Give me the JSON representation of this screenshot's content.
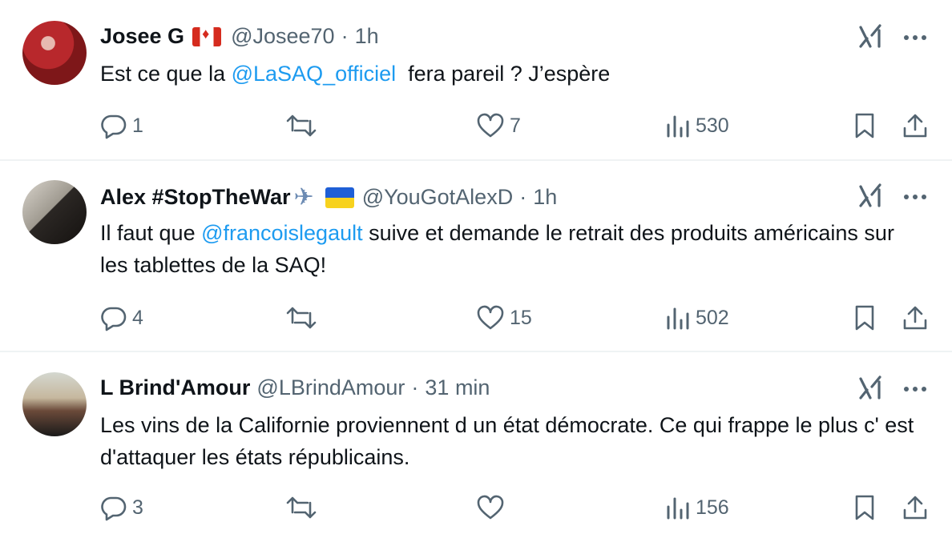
{
  "tweets": [
    {
      "name": "Josee G",
      "flag": "canada-flag",
      "handle": "@Josee70",
      "separator": "·",
      "time": "1h",
      "text_before": "Est ce que la ",
      "mention": "@LaSAQ_officiel",
      "text_after": "  fera pareil ? J’espère",
      "replies": "1",
      "retweets": "",
      "likes": "7",
      "views": "530"
    },
    {
      "name": "Alex #StopTheWar",
      "emoji": "airplane",
      "flag": "ukraine-flag",
      "handle": "@YouGotAlexD",
      "separator": "·",
      "time": "1h",
      "text_before": "Il faut que ",
      "mention": "@francoislegault",
      "text_after": " suive et demande le retrait des produits américains sur les tablettes de la SAQ!",
      "replies": "4",
      "retweets": "",
      "likes": "15",
      "views": "502"
    },
    {
      "name": "L Brind'Amour",
      "handle": "@LBrindAmour",
      "separator": "·",
      "time": "31 min",
      "text": "Les vins de la Californie proviennent d un état démocrate. Ce qui frappe le plus c' est d'attaquer les états républicains.",
      "replies": "3",
      "retweets": "",
      "likes": "",
      "views": "156"
    }
  ],
  "colors": {
    "text": "#0f1419",
    "secondary": "#536471",
    "link": "#1d9bf0",
    "divider": "#eff3f4"
  },
  "icons": [
    "reply-icon",
    "retweet-icon",
    "like-icon",
    "views-icon",
    "bookmark-icon",
    "share-icon",
    "grok-icon",
    "more-icon"
  ]
}
